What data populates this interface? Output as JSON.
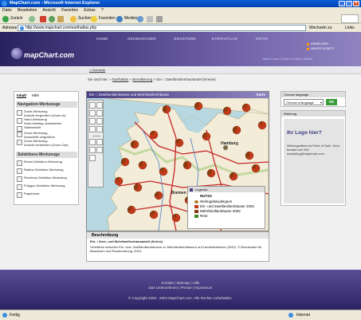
{
  "window": {
    "title": "MapChart.com - Microsoft Internet Explorer"
  },
  "menu": [
    "Datei",
    "Bearbeiten",
    "Ansicht",
    "Favoriten",
    "Extras",
    "?"
  ],
  "toolbar": {
    "back": "Zurück",
    "search": "Suchen",
    "favorites": "Favoriten",
    "media": "Medien"
  },
  "address": {
    "label": "Adresse",
    "url": "http://www.mapchart.com/earthatlas.php",
    "go": "Wechseln zu",
    "links": "Links"
  },
  "site": {
    "logo": "mapChart.com",
    "nav": [
      "HOME",
      "GEOMANAGER",
      "GEOSTORE",
      "EARTHATLAS",
      "INFOS"
    ],
    "login": [
      "ANMELDEN",
      "NEUES KONTO"
    ],
    "meta": "Main Forum | Home Contact | Imprint",
    "subnav": "» Startseite"
  },
  "breadcrumb": {
    "prefix": "Sie sind hier:",
    "l1": "Earthatlas",
    "l2": "Bevölkerung",
    "current": "Ein- / Zweifamilienhausanteil (Kreise)"
  },
  "left": {
    "tab1": "Inhalt",
    "tab2": "Hilfe",
    "nav_title": "Navigation-Werkzeuge",
    "nav_items": [
      {
        "label": "Zoom-Werkzeug",
        "sub": "Ansicht vergrößern (Zoom-In)"
      },
      {
        "label": "Hand-Werkzeug",
        "sub": "Karte beliebig verschieben"
      },
      {
        "label": "Startansicht",
        "sub": ""
      },
      {
        "label": "Zoom-Werkzeug",
        "sub": "Ausschnitt vergrößern"
      },
      {
        "label": "Zoom-Werkzeug",
        "sub": "Ansicht verkleinern (Zoom-Out)"
      }
    ],
    "sel_title": "Selektions-Werkzeuge",
    "sel_items": [
      "Einzel-Selektion-Werkzeug",
      "Radius-Selektion-Werkzeug",
      "Rechteck-Selektion-Werkzeug",
      "Polygon-Selektion-Werkzeug",
      "Papierkorb"
    ]
  },
  "map": {
    "title": "Ein- / Zweifamilienhäuser und Mehrfamilienhäuser",
    "karte": "Karte",
    "city": "Hamburg",
    "city2": "Bremen",
    "legend_title": "Legende",
    "legend_level": "NUTS3",
    "legend_heading": "Wohngebäudetypen",
    "legend_items": [
      {
        "label": "Ein- und Zweifamilienhäuser 2002",
        "color": "#c0391b"
      },
      {
        "label": "Mehrfamilienhäuser 2002",
        "color": "#8a3a0c"
      },
      {
        "label": "Rest",
        "color": "#3c8c2c"
      }
    ]
  },
  "description": {
    "title": "Beschreibung",
    "heading": "Ein- / Zwei- und Mehrfamilienhausanteil (Kreise)",
    "body": "Verhältnis zwischen Ein- bzw. Zweifamilienhäusern zu Mehrfamilienhäusern auf Landkreisebene (2002). © Bundesamt für Bauwesen und Raumordnung, 2004."
  },
  "right": {
    "lang_label": "Choose language",
    "lang_value": "Choose a language",
    "ok": "OK",
    "werbung": "Werbung",
    "ad_big": "Ihr Logo hier?",
    "ad_small": "Werbegrafiken im Point of Sale. Gern beraten wir Sie! marketing@mapchart.com"
  },
  "footer": {
    "l1": "Kontakt | Sitemap | Hilfe",
    "l2": "Das Unternehmen | Presse | Impressum",
    "l3": "© Copyright 2003 - 2004 MapChart.com. Alle Rechte vorbehalten."
  },
  "status": {
    "left": "Fertig",
    "right": "Internet"
  }
}
